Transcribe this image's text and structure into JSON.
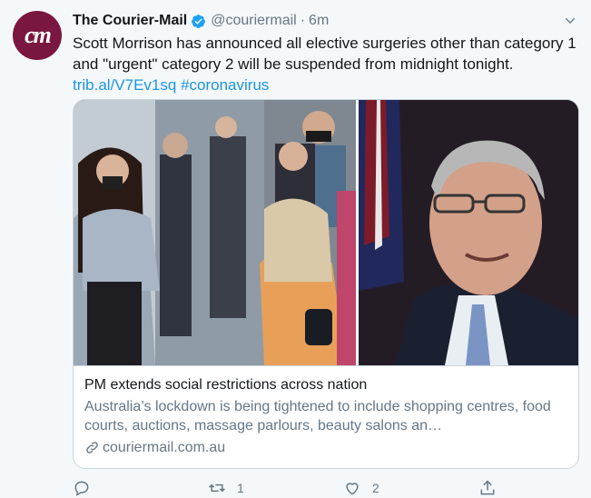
{
  "account": {
    "avatar_initials": "cm",
    "name": "The Courier-Mail",
    "handle": "@couriermail",
    "separator": "·",
    "time": "6m",
    "brand_color": "#7a1740",
    "verified_color": "#1da1f2"
  },
  "tweet": {
    "text": "Scott Morrison has announced all elective surgeries other than category 1 and \"urgent\" category 2 will be suspended from midnight tonight. ",
    "link": "trib.al/V7Ev1sq",
    "hashtag": "#coronavirus"
  },
  "card": {
    "title": "PM extends social restrictions across nation",
    "description": "Australia’s lockdown is being tightened to include shopping centres, food courts, auctions, massage parlours, beauty salons an…",
    "url": "couriermail.com.au"
  },
  "actions": {
    "retweets": "1",
    "likes": "2"
  },
  "icons": [
    "verified-icon",
    "chevron-down-icon",
    "link-icon",
    "reply-icon",
    "retweet-icon",
    "like-icon",
    "share-icon"
  ]
}
